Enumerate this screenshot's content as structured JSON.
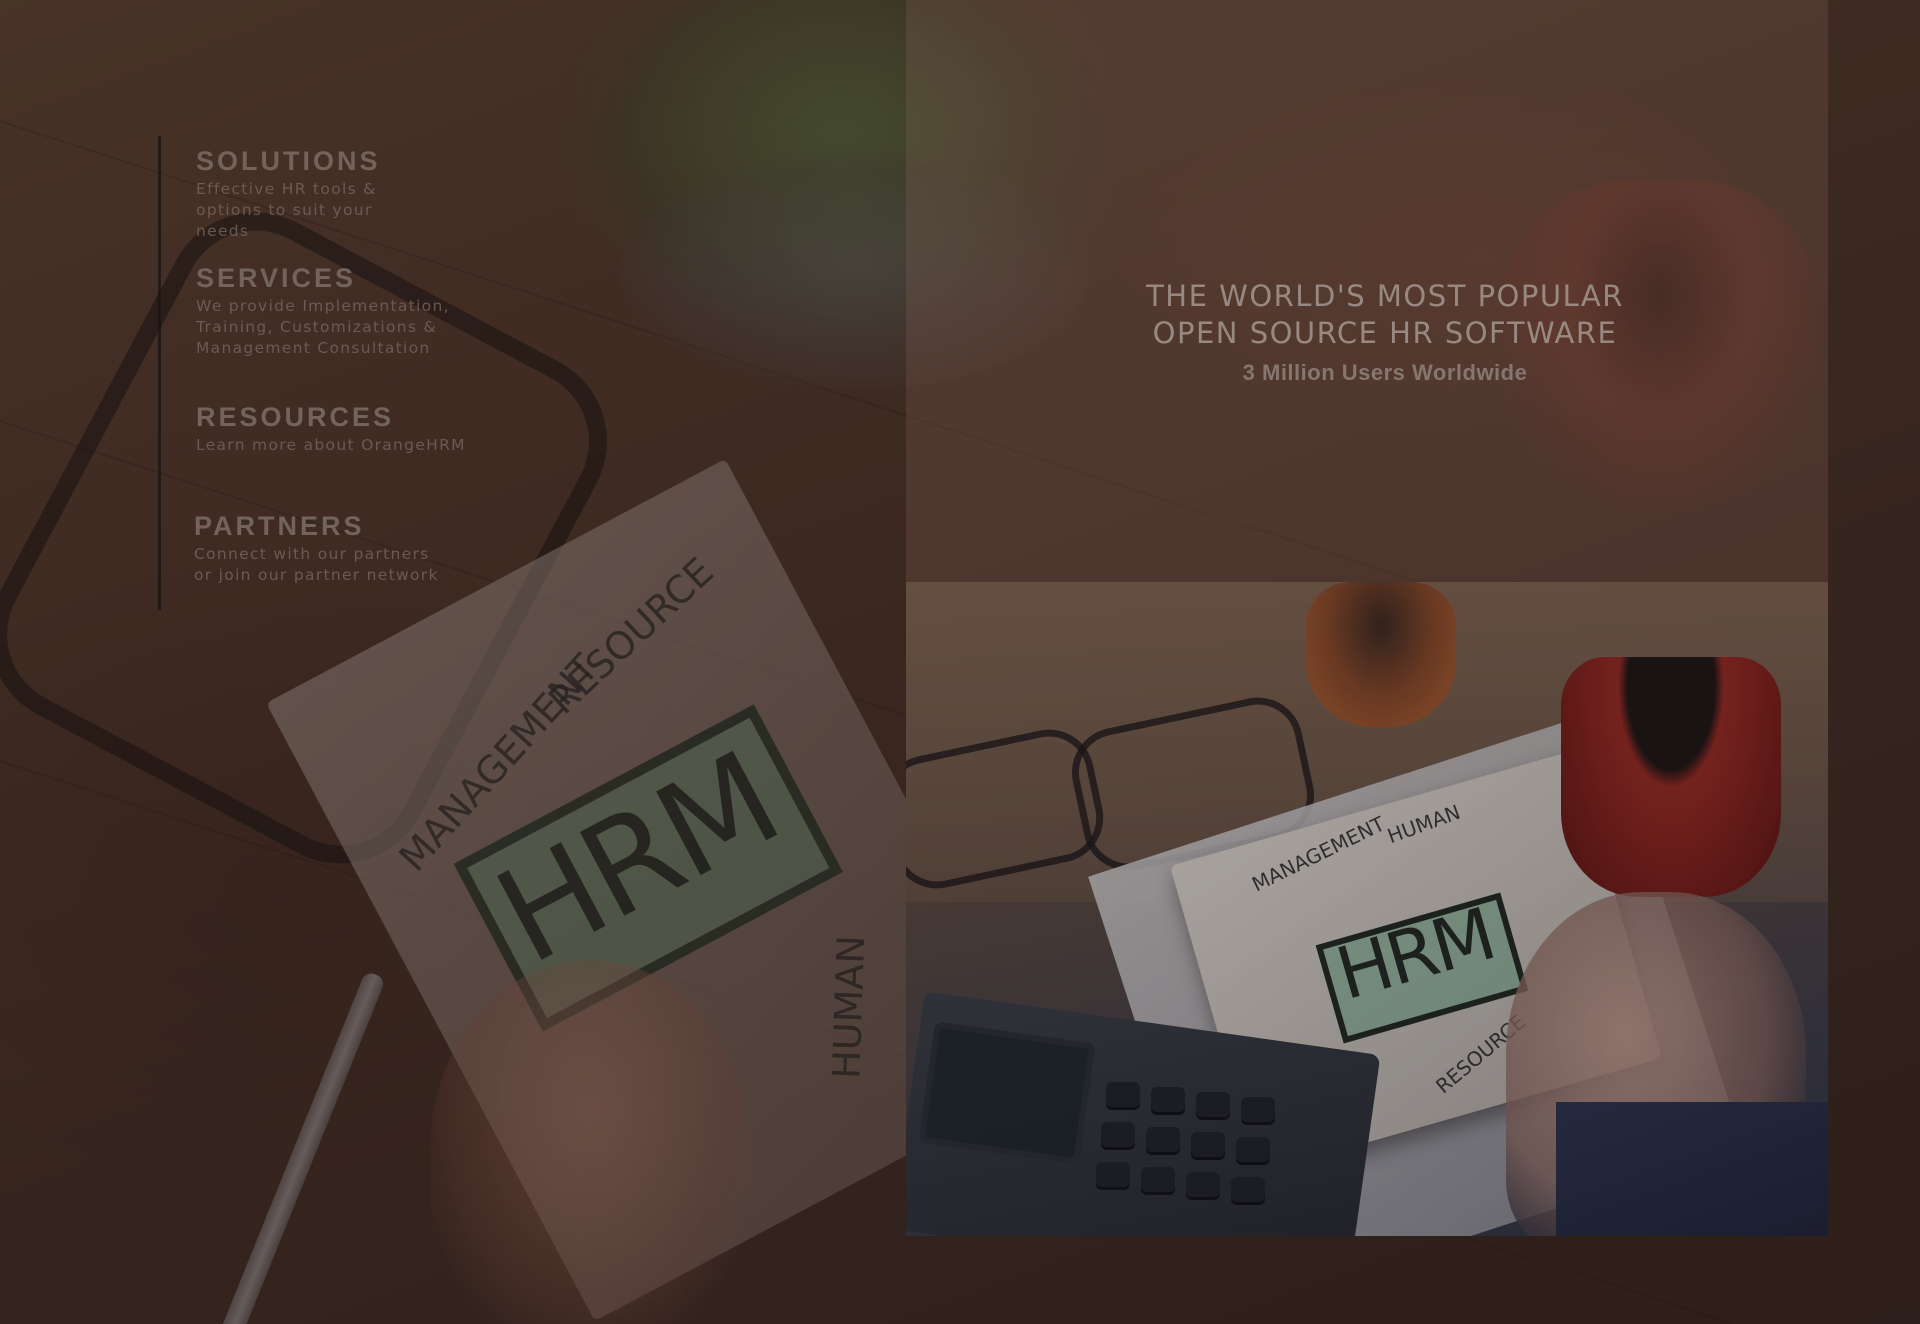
{
  "nav": {
    "items": [
      {
        "title": "SOLUTIONS",
        "desc_lines": [
          "Effective HR tools &",
          "options to suit your",
          "needs"
        ]
      },
      {
        "title": "SERVICES",
        "desc_lines": [
          "We provide Implementation,",
          "Training, Customizations &",
          "Management Consultation"
        ]
      },
      {
        "title": "RESOURCES",
        "desc_lines": [
          "Learn more about OrangeHRM"
        ]
      },
      {
        "title": "PARTNERS",
        "desc_lines": [
          "Connect with our partners",
          "or join our partner network"
        ]
      }
    ]
  },
  "hero": {
    "line1": "THE WORLD'S MOST POPULAR",
    "line2": "OPEN SOURCE HR SOFTWARE",
    "subtitle": "3 Million Users Worldwide"
  },
  "background_photo": {
    "notebook_words": [
      "MANAGEMENT",
      "RESOURCE",
      "HRM",
      "HUMAN"
    ]
  },
  "product_photo": {
    "notebook_words": [
      "MANAGEMENT",
      "HUMAN",
      "HRM",
      "RESOURCE"
    ]
  },
  "colors": {
    "menu_rule": "#191414",
    "overlay": "#1e1412",
    "mug_red": "#9a2a22",
    "hrm_highlight": "#6eaf8c"
  }
}
